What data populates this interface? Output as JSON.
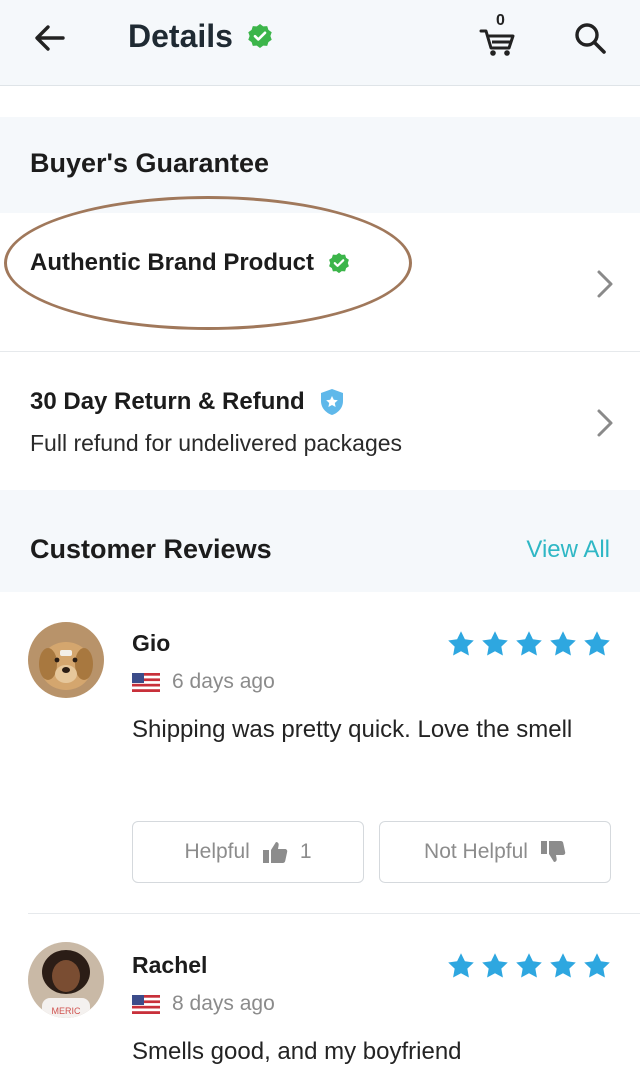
{
  "header": {
    "back_icon": "arrow-left-icon",
    "title": "Details",
    "verified_icon": "verified-check-icon",
    "cart_icon": "cart-icon",
    "cart_count": "0",
    "search_icon": "search-icon"
  },
  "guarantee": {
    "title": "Buyer's Guarantee",
    "items": [
      {
        "title": "Authentic Brand Product",
        "icon": "verified-check-icon",
        "subtitle": ""
      },
      {
        "title": "30 Day Return & Refund",
        "icon": "shield-star-icon",
        "subtitle": "Full refund for undelivered packages"
      }
    ]
  },
  "reviews": {
    "title": "Customer Reviews",
    "view_all": "View All",
    "items": [
      {
        "name": "Gio",
        "rating": 5,
        "flag": "us-flag-icon",
        "time": "6 days ago",
        "text": "Shipping was pretty quick. Love the smell",
        "helpful_label": "Helpful",
        "helpful_count": "1",
        "not_helpful_label": "Not Helpful"
      },
      {
        "name": "Rachel",
        "rating": 5,
        "flag": "us-flag-icon",
        "time": "8 days ago",
        "text": "Smells good, and my boyfriend"
      }
    ]
  },
  "colors": {
    "accent": "#2fb7c5",
    "star": "#2ea7e0",
    "verified": "#3cb54a",
    "shield": "#5fb8ea",
    "section_bg": "#f5f8fb",
    "annotation_oval": "#a0785b"
  }
}
